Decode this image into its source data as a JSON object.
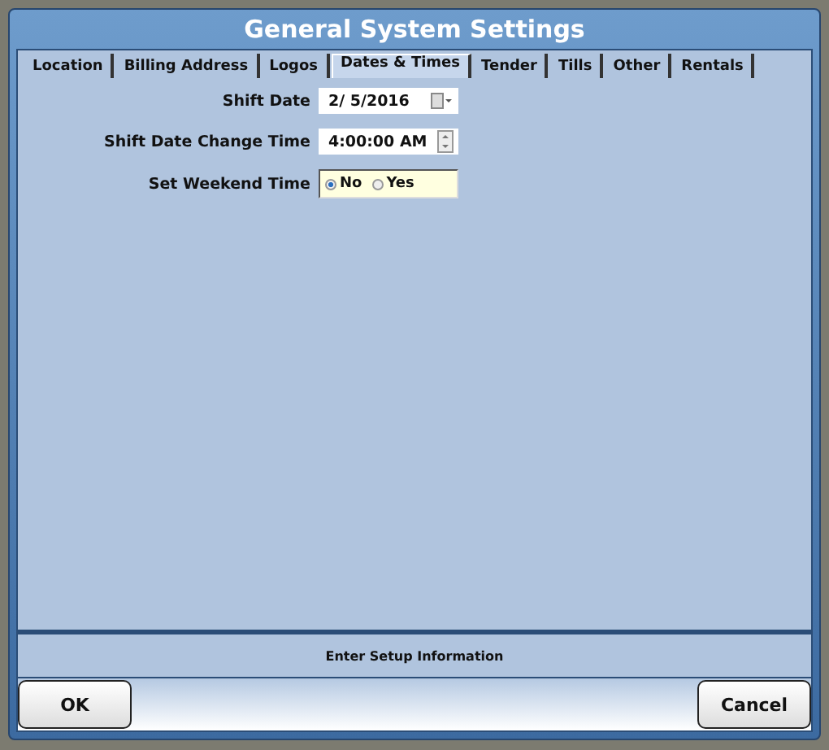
{
  "window": {
    "title": "General System Settings"
  },
  "tabs": [
    {
      "label": "Location",
      "selected": false
    },
    {
      "label": "Billing Address",
      "selected": false
    },
    {
      "label": "Logos",
      "selected": false
    },
    {
      "label": "Dates & Times",
      "selected": true
    },
    {
      "label": "Tender",
      "selected": false
    },
    {
      "label": "Tills",
      "selected": false
    },
    {
      "label": "Other",
      "selected": false
    },
    {
      "label": "Rentals",
      "selected": false
    }
  ],
  "fields": [
    {
      "kind": "date",
      "label": "Shift Date",
      "value": "2/  5/2016"
    },
    {
      "kind": "time",
      "label": "Shift Date Change Time",
      "value": "4:00:00 AM"
    },
    {
      "kind": "radio",
      "label": "Set Weekend Time",
      "options": [
        {
          "label": "No",
          "selected": true
        },
        {
          "label": "Yes",
          "selected": false
        }
      ]
    }
  ],
  "status_bar": "Enter Setup Information",
  "buttons": [
    "OK",
    "Cancel"
  ]
}
